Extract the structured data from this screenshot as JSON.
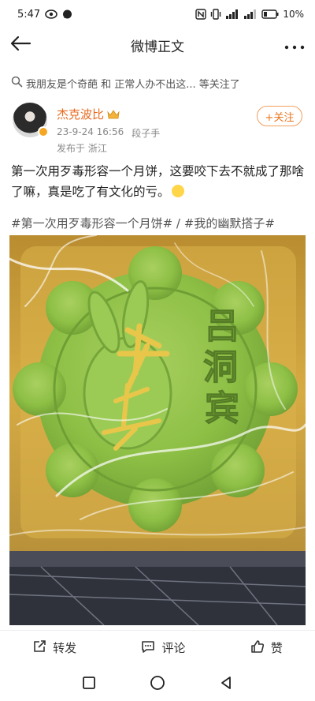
{
  "status_bar": {
    "time": "5:47",
    "battery": "10%"
  },
  "nav": {
    "title": "微博正文"
  },
  "follow_hint": {
    "text": "我朋友是个奇葩 和 正常人办不出这... 等关注了"
  },
  "author": {
    "name": "杰克波比",
    "date": "23-9-24 16:56",
    "tag": "段子手",
    "location": "发布于 浙江",
    "follow_label": "+关注"
  },
  "post": {
    "text": "第一次用歹毒形容一个月饼，这要咬下去不就成了那啥了嘛，真是吃了有文化的亏。",
    "hashtags": [
      "#第一次用歹毒形容一个月饼#",
      "/",
      "#我的幽默搭子#"
    ]
  },
  "mooncake": {
    "characters": [
      "吕",
      "洞",
      "宾"
    ]
  },
  "actions": {
    "repost": "转发",
    "comment": "评论",
    "like": "赞"
  },
  "colors": {
    "accent": "#e86b1f",
    "mooncake_green": "#8dbf45",
    "tray_gold": "#d1a53f"
  },
  "icons": {
    "back": "arrow-left-icon",
    "more": "more-dots-icon",
    "repost": "share-icon",
    "comment": "comment-icon",
    "like": "thumb-up-icon"
  }
}
